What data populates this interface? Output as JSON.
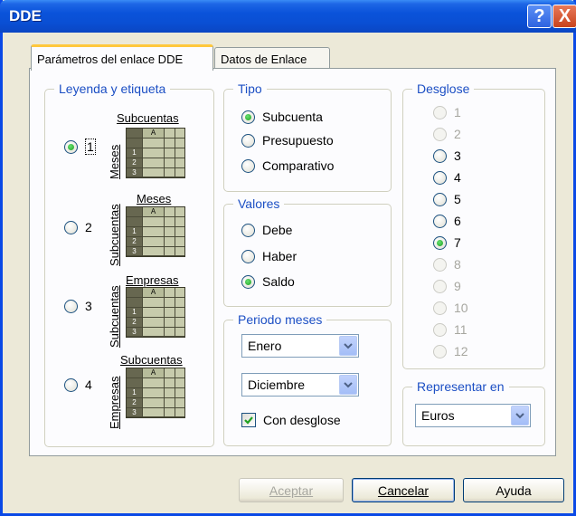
{
  "window": {
    "title": "DDE"
  },
  "titlebar": {
    "help_glyph": "?",
    "close_glyph": "X"
  },
  "tabs": [
    {
      "label": "Parámetros del enlace DDE"
    },
    {
      "label": "Datos de Enlace"
    }
  ],
  "leyenda": {
    "label": "Leyenda y etiqueta",
    "options": [
      {
        "number": "1",
        "top": "Subcuentas",
        "side": "Meses",
        "checked": true
      },
      {
        "number": "2",
        "top": "Meses",
        "side": "Subcuentas",
        "checked": false
      },
      {
        "number": "3",
        "top": "Empresas",
        "side": "Subcuentas",
        "checked": false
      },
      {
        "number": "4",
        "top": "Subcuentas",
        "side": "Empresas",
        "checked": false
      }
    ],
    "grid_col_header": "A",
    "grid_row_headers": [
      "1",
      "2",
      "3"
    ]
  },
  "tipo": {
    "label": "Tipo",
    "options": [
      "Subcuenta",
      "Presupuesto",
      "Comparativo"
    ],
    "selected": "Subcuenta"
  },
  "valores": {
    "label": "Valores",
    "options": [
      "Debe",
      "Haber",
      "Saldo"
    ],
    "selected": "Saldo"
  },
  "periodo": {
    "label": "Periodo meses",
    "from": "Enero",
    "to": "Diciembre",
    "con_desglose_label": "Con desglose",
    "con_desglose_checked": true
  },
  "desglose": {
    "label": "Desglose",
    "options": [
      "1",
      "2",
      "3",
      "4",
      "5",
      "6",
      "7",
      "8",
      "9",
      "10",
      "11",
      "12"
    ],
    "enabled": [
      "3",
      "4",
      "5",
      "6",
      "7"
    ],
    "selected": "7"
  },
  "representar": {
    "label": "Representar en",
    "value": "Euros"
  },
  "buttons": {
    "aceptar": "Aceptar",
    "cancelar": "Cancelar",
    "ayuda": "Ayuda"
  }
}
